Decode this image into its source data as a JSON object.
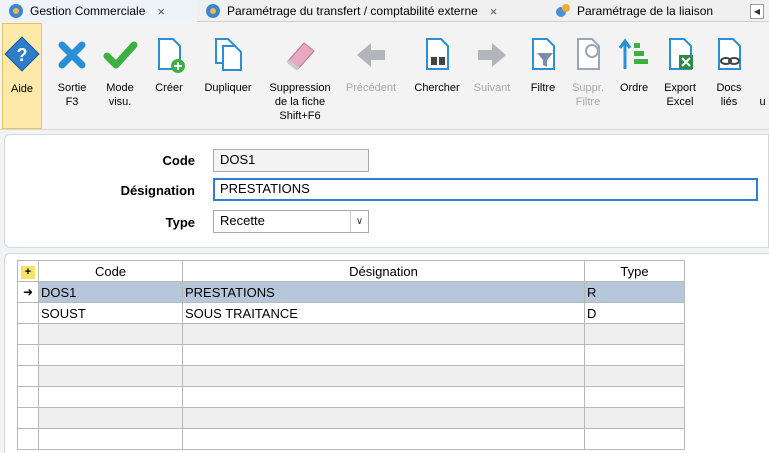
{
  "tabs": [
    {
      "label": "Gestion Commerciale",
      "close": "×"
    },
    {
      "label": "Paramétrage du transfert / comptabilité externe",
      "close": "×"
    },
    {
      "label": "Paramétrage de la liaison"
    }
  ],
  "tab_nav": "◀",
  "toolbar": {
    "aide": "Aide",
    "sortie": "Sortie\nF3",
    "mode_visu": "Mode\nvisu.",
    "creer": "Créer",
    "dupliquer": "Dupliquer",
    "suppression": "Suppression\nde la fiche\nShift+F6",
    "precedent": "Précédent",
    "chercher": "Chercher",
    "suivant": "Suivant",
    "filtre": "Filtre",
    "suppr_filtre": "Suppr.\nFiltre",
    "ordre": "Ordre",
    "export_excel": "Export\nExcel",
    "docs_lies": "Docs\nliés",
    "extra": "u"
  },
  "form": {
    "code_label": "Code",
    "code_value": "DOS1",
    "designation_label": "Désignation",
    "designation_value": "PRESTATIONS",
    "type_label": "Type",
    "type_value": "Recette"
  },
  "grid": {
    "corner": "+",
    "headers": {
      "code": "Code",
      "designation": "Désignation",
      "type": "Type"
    },
    "rows": [
      {
        "indicator": "➜",
        "code": "DOS1",
        "designation": "PRESTATIONS",
        "type": "R"
      },
      {
        "indicator": "",
        "code": "SOUST",
        "designation": "SOUS TRAITANCE",
        "type": "D"
      }
    ]
  },
  "colors": {
    "accent": "#2e7fd0",
    "selected_row": "#b7c7db",
    "active_button": "#fde9a9",
    "green_check": "#3cb043",
    "blue_x": "#2a8fd6"
  }
}
